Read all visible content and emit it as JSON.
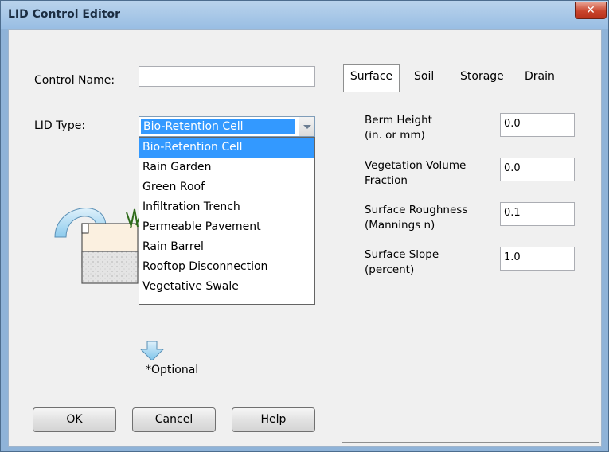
{
  "window": {
    "title": "LID Control Editor",
    "close_glyph": "✕"
  },
  "control_name": {
    "label": "Control Name:",
    "value": ""
  },
  "lid_type": {
    "label": "LID Type:",
    "selected": "Bio-Retention Cell",
    "options": [
      "Bio-Retention Cell",
      "Rain Garden",
      "Green Roof",
      "Infiltration Trench",
      "Permeable Pavement",
      "Rain Barrel",
      "Rooftop Disconnection",
      "Vegetative Swale"
    ]
  },
  "optional_note": "*Optional",
  "buttons": {
    "ok": "OK",
    "cancel": "Cancel",
    "help": "Help"
  },
  "tabs": [
    "Surface",
    "Soil",
    "Storage",
    "Drain"
  ],
  "surface": {
    "fields": [
      {
        "label": "Berm Height\n(in. or mm)",
        "value": "0.0"
      },
      {
        "label": "Vegetation Volume\nFraction",
        "value": "0.0"
      },
      {
        "label": "Surface Roughness\n(Mannings n)",
        "value": "0.1"
      },
      {
        "label": "Surface Slope\n(percent)",
        "value": "1.0"
      }
    ]
  },
  "colors": {
    "titlebar": "#98bde3",
    "selection": "#3399ff",
    "close": "#c9442c"
  },
  "icons": {
    "close": "close-icon",
    "dropdown": "chevron-down-icon",
    "diagram": "lid-diagram-icon"
  }
}
